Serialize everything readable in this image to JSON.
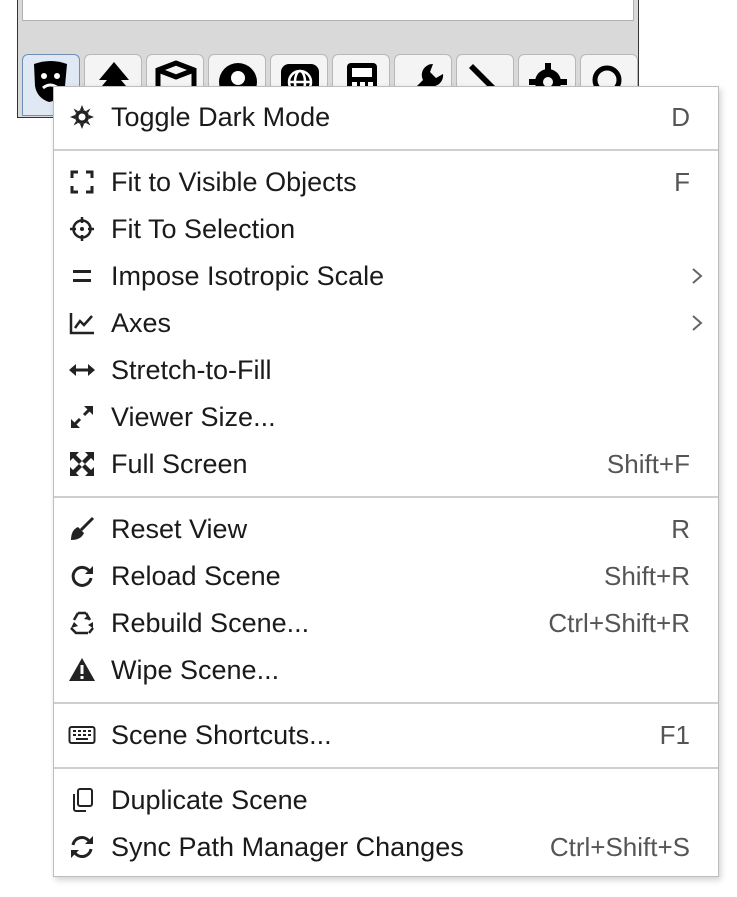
{
  "toolbar": {
    "buttons": [
      {
        "icon": "theater-masks-icon"
      },
      {
        "icon": "tree-icon"
      },
      {
        "icon": "box-icon"
      },
      {
        "icon": "user-circle-icon"
      },
      {
        "icon": "globe-icon"
      },
      {
        "icon": "calculator-icon"
      },
      {
        "icon": "wrench-icon"
      },
      {
        "icon": "pen-icon"
      },
      {
        "icon": "gear-icon"
      },
      {
        "icon": "search-icon"
      }
    ]
  },
  "menu": {
    "items": [
      {
        "label": "Toggle Dark Mode",
        "shortcut": "D",
        "icon": "sun-icon"
      },
      {
        "label": "Fit to Visible Objects",
        "shortcut": "F",
        "icon": "expand-corners-icon"
      },
      {
        "label": "Fit To Selection",
        "shortcut": "",
        "icon": "crosshair-icon"
      },
      {
        "label": "Impose Isotropic Scale",
        "shortcut": "",
        "icon": "equals-icon",
        "submenu": true
      },
      {
        "label": "Axes",
        "shortcut": "",
        "icon": "line-chart-icon",
        "submenu": true
      },
      {
        "label": "Stretch-to-Fill",
        "shortcut": "",
        "icon": "horizontal-arrows-icon"
      },
      {
        "label": "Viewer Size...",
        "shortcut": "",
        "icon": "diagonal-arrows-icon"
      },
      {
        "label": "Full Screen",
        "shortcut": "Shift+F",
        "icon": "fullscreen-icon"
      },
      {
        "label": "Reset View",
        "shortcut": "R",
        "icon": "broom-icon"
      },
      {
        "label": "Reload Scene",
        "shortcut": "Shift+R",
        "icon": "reload-icon"
      },
      {
        "label": "Rebuild Scene...",
        "shortcut": "Ctrl+Shift+R",
        "icon": "recycle-icon"
      },
      {
        "label": "Wipe Scene...",
        "shortcut": "",
        "icon": "warning-icon"
      },
      {
        "label": "Scene Shortcuts...",
        "shortcut": "F1",
        "icon": "keyboard-icon"
      },
      {
        "label": "Duplicate Scene",
        "shortcut": "",
        "icon": "copy-icon"
      },
      {
        "label": "Sync Path Manager Changes",
        "shortcut": "Ctrl+Shift+S",
        "icon": "sync-icon"
      }
    ]
  },
  "colors": {
    "menu_bg": "#ffffff",
    "separator": "#cfcfcf",
    "text": "#1a1a1a",
    "shortcut_text": "#555555"
  }
}
